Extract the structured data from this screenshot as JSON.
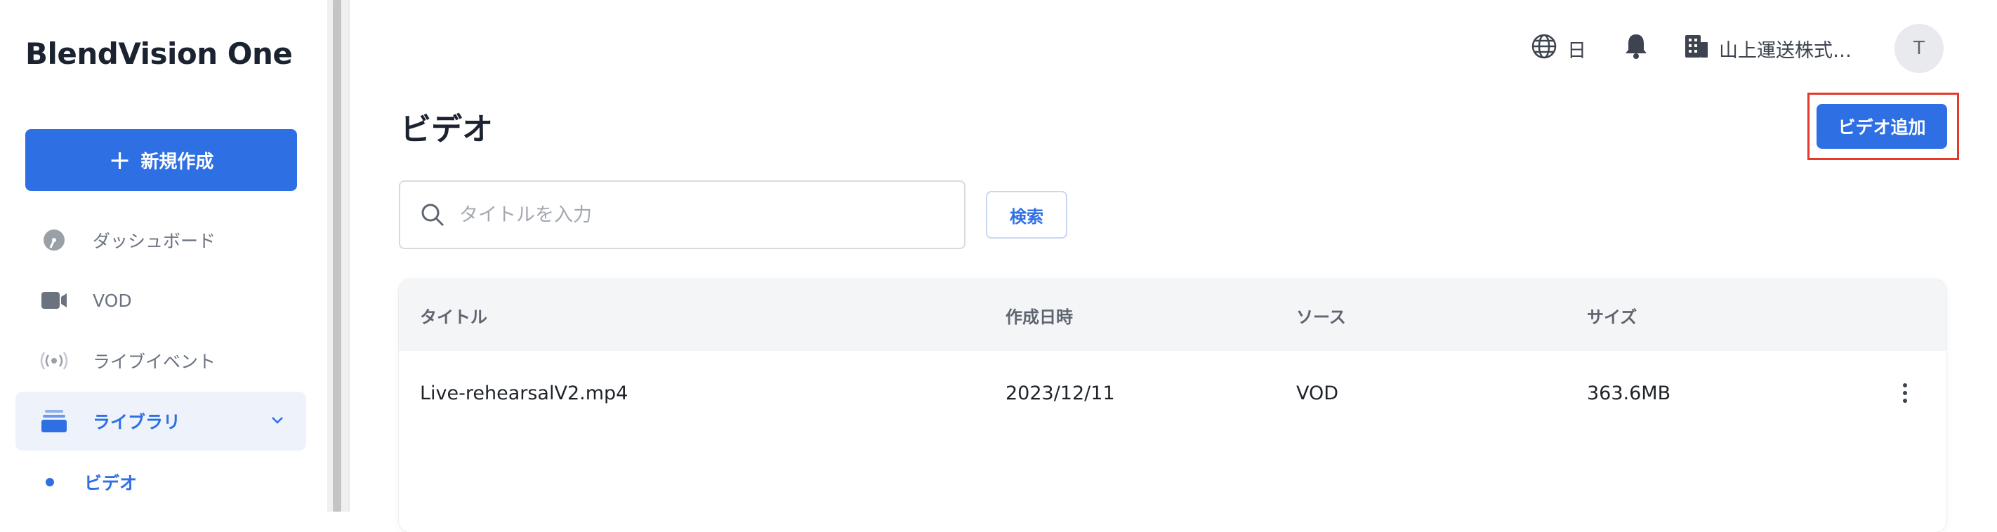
{
  "app": {
    "logo": "BlendVision One"
  },
  "sidebar": {
    "new_button_label": "新規作成",
    "items": [
      {
        "label": "ダッシュボード",
        "icon": "dashboard-icon"
      },
      {
        "label": "VOD",
        "icon": "video-camera-icon"
      },
      {
        "label": "ライブイベント",
        "icon": "broadcast-icon"
      },
      {
        "label": "ライブラリ",
        "icon": "library-icon",
        "active": true,
        "expanded": true
      }
    ],
    "subitems": [
      {
        "label": "ビデオ",
        "active": true
      }
    ]
  },
  "header": {
    "language": "日",
    "org_name": "山上運送株式…",
    "avatar_initial": "T"
  },
  "page": {
    "title": "ビデオ",
    "add_button_label": "ビデオ追加",
    "search_placeholder": "タイトルを入力",
    "search_button_label": "検索"
  },
  "table": {
    "columns": [
      "タイトル",
      "作成日時",
      "ソース",
      "サイズ"
    ],
    "rows": [
      {
        "title": "Live-rehearsalV2.mp4",
        "created": "2023/12/11",
        "source": "VOD",
        "size": "363.6MB"
      }
    ]
  },
  "colors": {
    "accent": "#2f6fe4",
    "highlight": "#e5392b"
  }
}
